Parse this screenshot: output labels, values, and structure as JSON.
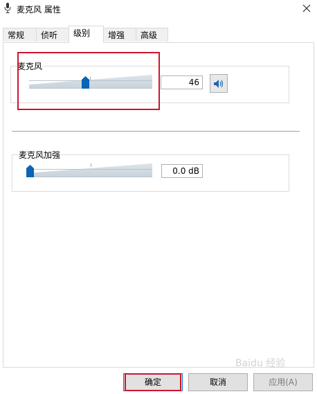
{
  "window": {
    "title": "麦克风 属性",
    "close_icon": "close-icon"
  },
  "tabs": [
    {
      "label": "常规"
    },
    {
      "label": "侦听"
    },
    {
      "label": "级别"
    },
    {
      "label": "增强"
    },
    {
      "label": "高级"
    }
  ],
  "active_tab": "级别",
  "microphone": {
    "label": "麦克风",
    "value": "46",
    "level": 0.46
  },
  "boost": {
    "label": "麦克风加强",
    "value": "0.0 dB",
    "level": 0.0
  },
  "buttons": {
    "ok": "确定",
    "cancel": "取消",
    "apply": "应用(A)"
  },
  "watermark": "Baidu 经验",
  "colors": {
    "highlight": "#d0142c",
    "thumb": "#0b64b5",
    "accent": "#0078d7"
  }
}
